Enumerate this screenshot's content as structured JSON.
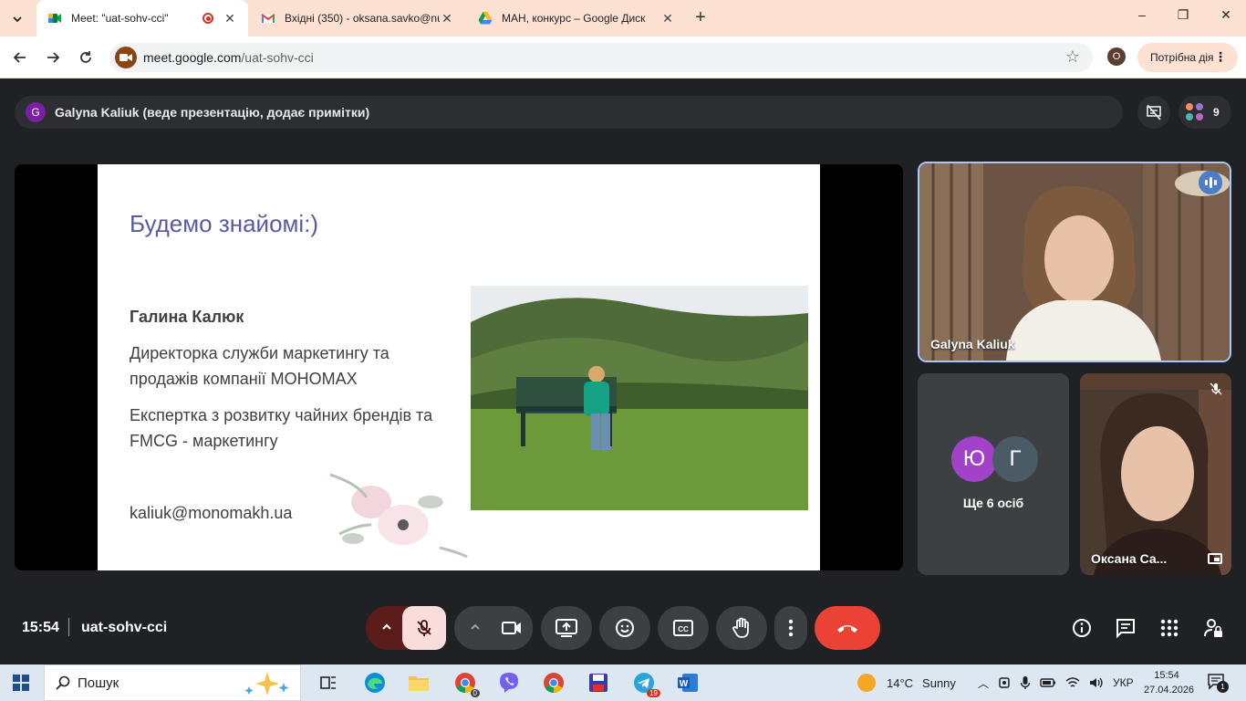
{
  "browser": {
    "tabs": [
      {
        "title": "Meet: \"uat-sohv-cci\"",
        "active": true,
        "recording": true
      },
      {
        "title": "Вхідні (350) - oksana.savko@nu",
        "active": false
      },
      {
        "title": "МАН, конкурс – Google Диск",
        "active": false
      }
    ],
    "new_tab": "+",
    "window_controls": {
      "minimize": "–",
      "restore": "❐",
      "close": "✕"
    },
    "url_host": "meet.google.com",
    "url_path": "/uat-sohv-cci",
    "profile_initial": "O",
    "action_label": "Потрібна дія"
  },
  "meet": {
    "banner_initial": "G",
    "banner_text": "Galyna Kaliuk (веде презентацію, додає примітки)",
    "participant_count": "9",
    "slide": {
      "heading": "Будемо знайомі:)",
      "name": "Галина Калюк",
      "role": "Директорка служби маркетингу та продажів компанії МОНОМАХ",
      "expertise": "Експертка з розвитку чайних брендів та FMCG - маркетингу",
      "email": "kaliuk@monomakh.ua"
    },
    "tiles": {
      "main_name": "Galyna Kaliuk",
      "others_avatars": [
        {
          "initial": "Ю",
          "color": "#a142c9"
        },
        {
          "initial": "Г",
          "color": "#4a5b66"
        }
      ],
      "others_label": "Ще 6 осіб",
      "oksana_name": "Оксана Са..."
    },
    "time": "15:54",
    "meeting_code": "uat-sohv-cci"
  },
  "taskbar": {
    "search_label": "Пошук",
    "weather_temp": "14°C",
    "weather_desc": "Sunny",
    "language": "УКР",
    "clock_time": "15:54",
    "clock_date": "27.04.2026",
    "chrome_badge": "0",
    "telegram_badge": "19",
    "notif_badge": "1"
  },
  "colors": {
    "meet_bg": "#202124",
    "control_bg": "#3c4043",
    "end_call": "#ea4335",
    "mic_off_bg": "#f9dedc",
    "tab_strip": "#fde2d4",
    "slide_heading": "#5a5aa0",
    "speaking_blue": "#a8c7fa"
  }
}
